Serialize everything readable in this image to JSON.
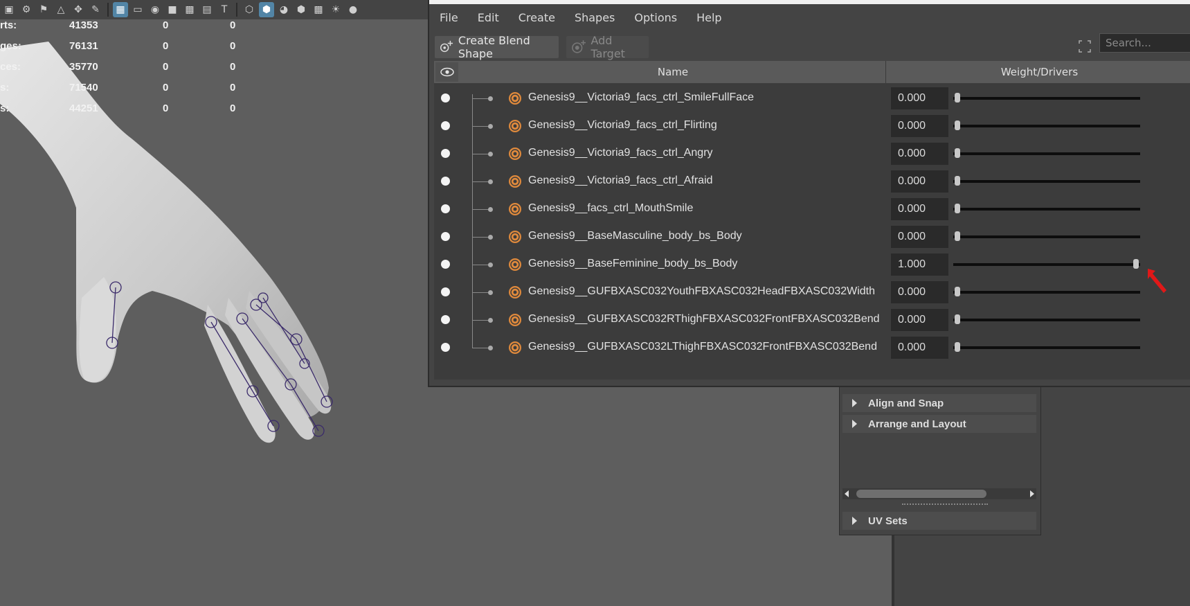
{
  "viewport": {
    "hud": [
      {
        "label": "rts:",
        "v1": "41353",
        "v2": "0",
        "v3": "0"
      },
      {
        "label": "ges:",
        "v1": "76131",
        "v2": "0",
        "v3": "0"
      },
      {
        "label": "ces:",
        "v1": "35770",
        "v2": "0",
        "v3": "0"
      },
      {
        "label": "s:",
        "v1": "71540",
        "v2": "0",
        "v3": "0"
      },
      {
        "label": "s:",
        "v1": "44251",
        "v2": "0",
        "v3": "0"
      }
    ]
  },
  "shape_editor": {
    "menu": [
      "File",
      "Edit",
      "Create",
      "Shapes",
      "Options",
      "Help"
    ],
    "toolbar": {
      "create_label": "Create Blend Shape",
      "add_label": "Add Target",
      "search_placeholder": "Search..."
    },
    "columns": {
      "name": "Name",
      "weight": "Weight/Drivers"
    },
    "targets": [
      {
        "name": "Genesis9__Victoria9_facs_ctrl_SmileFullFace",
        "weight": "0.000",
        "value": 0
      },
      {
        "name": "Genesis9__Victoria9_facs_ctrl_Flirting",
        "weight": "0.000",
        "value": 0
      },
      {
        "name": "Genesis9__Victoria9_facs_ctrl_Angry",
        "weight": "0.000",
        "value": 0
      },
      {
        "name": "Genesis9__Victoria9_facs_ctrl_Afraid",
        "weight": "0.000",
        "value": 0
      },
      {
        "name": "Genesis9__facs_ctrl_MouthSmile",
        "weight": "0.000",
        "value": 0
      },
      {
        "name": "Genesis9__BaseMasculine_body_bs_Body",
        "weight": "0.000",
        "value": 0
      },
      {
        "name": "Genesis9__BaseFeminine_body_bs_Body",
        "weight": "1.000",
        "value": 1
      },
      {
        "name": "Genesis9__GUFBXASC032YouthFBXASC032HeadFBXASC032Width",
        "weight": "0.000",
        "value": 0
      },
      {
        "name": "Genesis9__GUFBXASC032RThighFBXASC032FrontFBXASC032Bend",
        "weight": "0.000",
        "value": 0
      },
      {
        "name": "Genesis9__GUFBXASC032LThighFBXASC032FrontFBXASC032Bend",
        "weight": "0.000",
        "value": 0
      }
    ]
  },
  "attribute_panel": {
    "sections": [
      "Align and Snap",
      "Arrange and Layout",
      "UV Sets"
    ]
  },
  "colors": {
    "accent": "#5285a6",
    "target_icon": "#e08a3c",
    "pointer": "#e01818"
  }
}
